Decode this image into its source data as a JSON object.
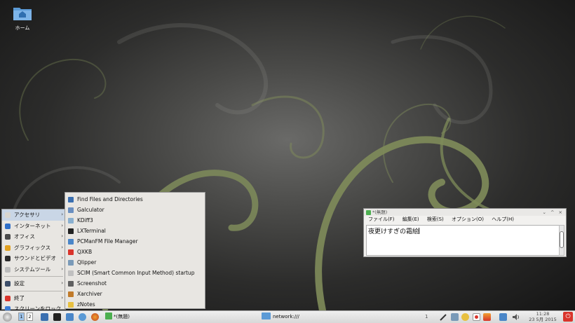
{
  "desktop": {
    "home_label": "ホーム"
  },
  "menu": {
    "items": [
      {
        "label": "アクセサリ",
        "color": "#d9d6cf"
      },
      {
        "label": "インターネット",
        "color": "#2f6fc8"
      },
      {
        "label": "オフィス",
        "color": "#4a4a4a"
      },
      {
        "label": "グラフィックス",
        "color": "#e0a020"
      },
      {
        "label": "サウンドとビデオ",
        "color": "#2a2a2a"
      },
      {
        "label": "システムツール",
        "color": "#bbbbbb"
      },
      {
        "label": "設定",
        "color": "#3d4f6a"
      },
      {
        "label": "終了",
        "color": "#d9342b"
      },
      {
        "label": "スクリーンをロック",
        "color": "#3a7bd5"
      }
    ],
    "arrow": "›"
  },
  "submenu": {
    "items": [
      {
        "label": "Find Files and Directories",
        "color": "#3a6fb0"
      },
      {
        "label": "Galculator",
        "color": "#6a8fc0"
      },
      {
        "label": "KDiff3",
        "color": "#8ab0d0"
      },
      {
        "label": "LXTerminal",
        "color": "#222222"
      },
      {
        "label": "PCManFM File Manager",
        "color": "#4a86c8"
      },
      {
        "label": "QXKB",
        "color": "#d9342b"
      },
      {
        "label": "Qlipper",
        "color": "#7a9ab8"
      },
      {
        "label": "SCIM (Smart Common Input Method) startup",
        "color": "#c0c0c0"
      },
      {
        "label": "Screenshot",
        "color": "#606060"
      },
      {
        "label": "Xarchiver",
        "color": "#c07a2a"
      },
      {
        "label": "zNotes",
        "color": "#e8c040"
      }
    ]
  },
  "editor": {
    "title": "*(無題)",
    "controls": "⌄ ^ ×",
    "menus": [
      "ファイル(F)",
      "編集(E)",
      "検索(S)",
      "オプション(O)",
      "ヘルプ(H)"
    ],
    "content": "夜更けすぎの霜絵"
  },
  "taskbar": {
    "pager": [
      "1",
      "2"
    ],
    "task_label": "*(無題)",
    "center_label": "network:///",
    "desktop_num": "1",
    "time": "11:28",
    "date": "23 5月 2015"
  }
}
